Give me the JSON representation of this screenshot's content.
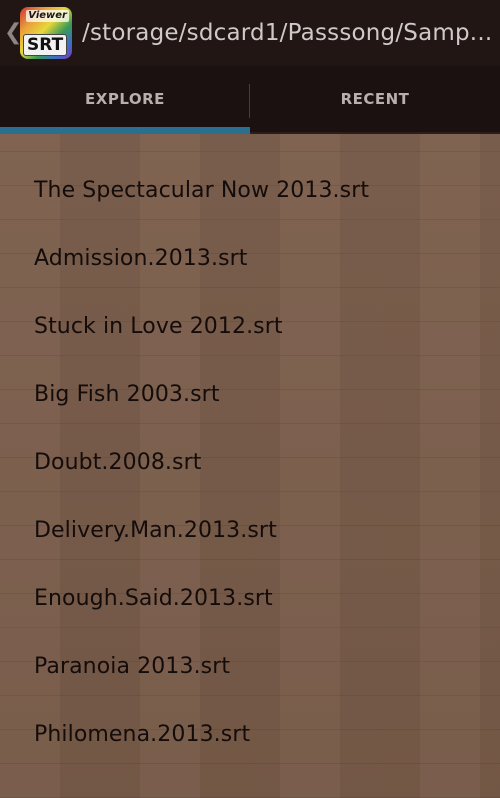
{
  "action_bar": {
    "up_icon": "chevron-left-icon",
    "app_icon": {
      "name": "srt-viewer-app-icon",
      "small_text": "Viewer",
      "big_text": "SRT"
    },
    "title": "/storage/sdcard1/Passsong/Samp..."
  },
  "tabs": [
    {
      "label": "EXPLORE",
      "selected": true
    },
    {
      "label": "RECENT",
      "selected": false
    }
  ],
  "colors": {
    "action_bar_bg": "#221615",
    "tab_indicator": "#2a6f8f",
    "list_bg": "#7a5e4c",
    "list_text": "#140c0a"
  },
  "files": [
    {
      "name": "The Spectacular Now 2013.srt"
    },
    {
      "name": "Admission.2013.srt"
    },
    {
      "name": "Stuck in Love 2012.srt"
    },
    {
      "name": "Big Fish 2003.srt"
    },
    {
      "name": "Doubt.2008.srt"
    },
    {
      "name": "Delivery.Man.2013.srt"
    },
    {
      "name": "Enough.Said.2013.srt"
    },
    {
      "name": "Paranoia 2013.srt"
    },
    {
      "name": "Philomena.2013.srt"
    }
  ]
}
